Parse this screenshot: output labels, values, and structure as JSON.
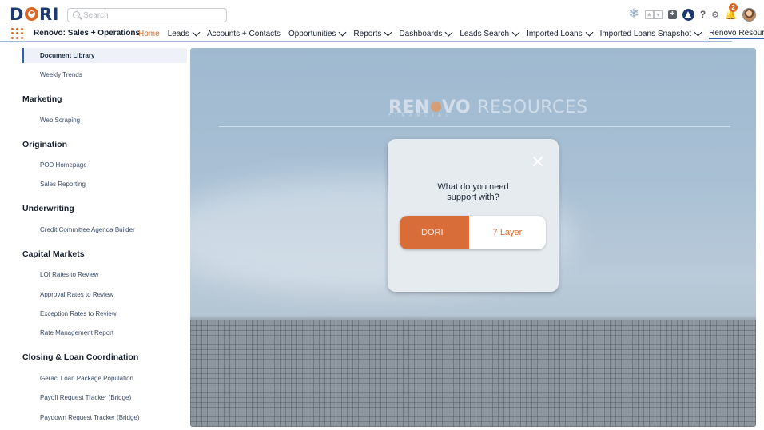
{
  "app": {
    "logo_text": "DORI",
    "name": "Renovo: Sales + Operations"
  },
  "search": {
    "placeholder": "Search",
    "value": ""
  },
  "utility_icons": [
    "snowflake-icon",
    "favorites-icon",
    "add-icon",
    "trailhead-icon",
    "help-icon",
    "setup-gear-icon",
    "notifications-bell-icon",
    "user-avatar"
  ],
  "notifications": {
    "count": "2"
  },
  "nav": {
    "tabs": [
      {
        "label": "Home",
        "active": true,
        "has_menu": false
      },
      {
        "label": "Leads",
        "active": false,
        "has_menu": true
      },
      {
        "label": "Accounts + Contacts",
        "active": false,
        "has_menu": false
      },
      {
        "label": "Opportunities",
        "active": false,
        "has_menu": true
      },
      {
        "label": "Reports",
        "active": false,
        "has_menu": true
      },
      {
        "label": "Dashboards",
        "active": false,
        "has_menu": true
      },
      {
        "label": "Leads Search",
        "active": false,
        "has_menu": true
      },
      {
        "label": "Imported Loans",
        "active": false,
        "has_menu": true
      },
      {
        "label": "Imported Loans Snapshot",
        "active": false,
        "has_menu": true
      },
      {
        "label": "Renovo Resource",
        "active": false,
        "has_menu": false
      }
    ]
  },
  "sidebar": {
    "selected_item": "Document Library",
    "sections": [
      {
        "heading": "",
        "items": [
          "Document Library",
          "Weekly Trends"
        ]
      },
      {
        "heading": "Marketing",
        "items": [
          "Web Scraping"
        ]
      },
      {
        "heading": "Origination",
        "items": [
          "POD Homepage",
          "Sales Reporting"
        ]
      },
      {
        "heading": "Underwriting",
        "items": [
          "Credit Committee Agenda Builder"
        ]
      },
      {
        "heading": "Capital Markets",
        "items": [
          "LOI Rates to Review",
          "Approval Rates to Review",
          "Exception Rates to Review",
          "Rate Management Report"
        ]
      },
      {
        "heading": "Closing & Loan Coordination",
        "items": [
          "Geraci Loan Package Population",
          "Payoff Request Tracker (Bridge)",
          "Paydown Request Tracker (Bridge)"
        ]
      }
    ]
  },
  "banner": {
    "brand": "REN",
    "brand_tail": "VO",
    "word": "RESOURCES",
    "tagline": "FINANCIAL"
  },
  "modal": {
    "question": "What do you need support with?",
    "option_a": "DORI",
    "option_b": "7 Layer"
  },
  "colors": {
    "accent": "#d56a2a",
    "brand_navy": "#1e3a6e",
    "nav_underline": "#2f5fad"
  }
}
